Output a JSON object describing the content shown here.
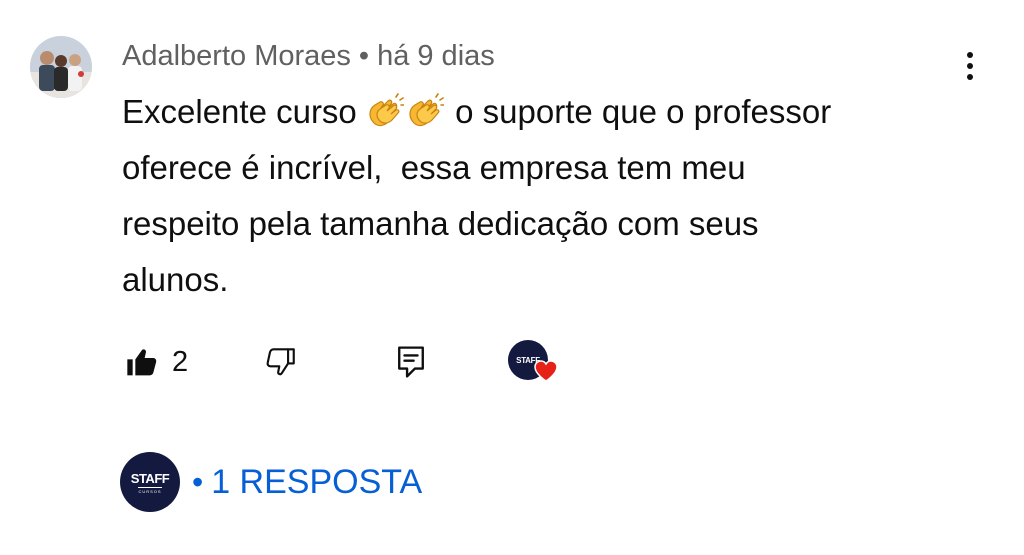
{
  "comment": {
    "author": "Adalberto Moraes",
    "separator": "•",
    "time": "há 9 dias",
    "text_lines": [
      [
        "Excelente curso ",
        " o suporte que o professor"
      ],
      "oferece é incrível,  essa empresa tem meu",
      "respeito pela tamanha dedicação com seus",
      "alunos."
    ],
    "emoji": [
      "clapping-hands",
      "clapping-hands"
    ]
  },
  "actions": {
    "like_count": "2",
    "icons": [
      "thumbs-up-filled-icon",
      "thumbs-down-icon",
      "reply-comment-icon",
      "creator-heart-badge"
    ]
  },
  "creator_badge": {
    "text": "STAFF",
    "heart_color": "#e62117"
  },
  "replies": {
    "avatar_text": "STAFF",
    "avatar_subtext": "CURSOS",
    "separator": "•",
    "label": "1 RESPOSTA"
  },
  "colors": {
    "meta_text": "#606060",
    "body_text": "#0f0f0f",
    "link_blue": "#065fd4",
    "staff_navy": "#141a3f"
  }
}
